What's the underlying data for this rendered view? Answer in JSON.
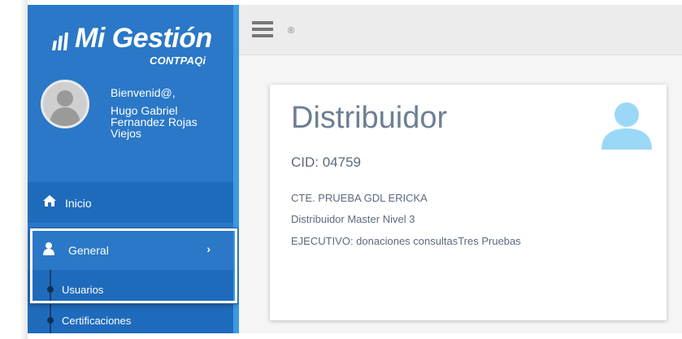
{
  "brand": {
    "title": "Mi Gestión",
    "subtitle": "CONTPAQi"
  },
  "user": {
    "greeting": "Bienvenid@,",
    "name": "Hugo Gabriel Fernandez Rojas Viejos"
  },
  "sidebar": {
    "items": [
      {
        "label": "Inicio",
        "icon": "home-icon"
      },
      {
        "label": "General",
        "icon": "user-icon",
        "chevron": "›"
      }
    ],
    "submenu": [
      {
        "label": "Usuarios"
      },
      {
        "label": "Certificaciones"
      }
    ]
  },
  "topbar": {
    "registered": "®"
  },
  "card": {
    "title": "Distribuidor",
    "cid": "CID: 04759",
    "lines": [
      "CTE. PRUEBA GDL ERICKA",
      "Distribuidor Master Nivel 3",
      "EJECUTIVO: donaciones consultasTres Pruebas"
    ]
  },
  "colors": {
    "sidebar": "#2a78c7",
    "sidebar_active": "#1f6bbb",
    "card_icon": "#9bd8f7",
    "title_text": "#6e7f93"
  }
}
